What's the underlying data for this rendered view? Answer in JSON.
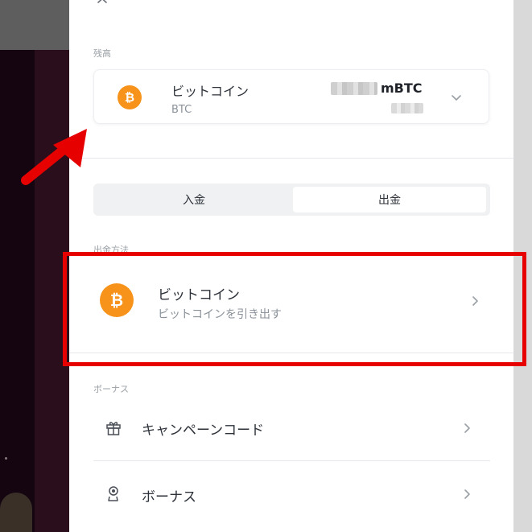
{
  "balance": {
    "section_label": "残高",
    "currency_name": "ビットコイン",
    "currency_code": "BTC",
    "unit": "mBTC",
    "coin_symbol": "₿"
  },
  "tabs": [
    {
      "label": "入金",
      "active": false
    },
    {
      "label": "出金",
      "active": true
    }
  ],
  "withdraw_method": {
    "section_label": "出金方法",
    "name": "ビットコイン",
    "description": "ビットコインを引き出す",
    "coin_symbol": "₿"
  },
  "bonus": {
    "section_label": "ボーナス",
    "items": [
      {
        "label": "キャンペーンコード",
        "icon": "gift-icon"
      },
      {
        "label": "ボーナス",
        "icon": "award-icon"
      }
    ]
  },
  "colors": {
    "bitcoin": "#f7931a",
    "highlight": "#e60000",
    "arrow": "#e60000"
  }
}
